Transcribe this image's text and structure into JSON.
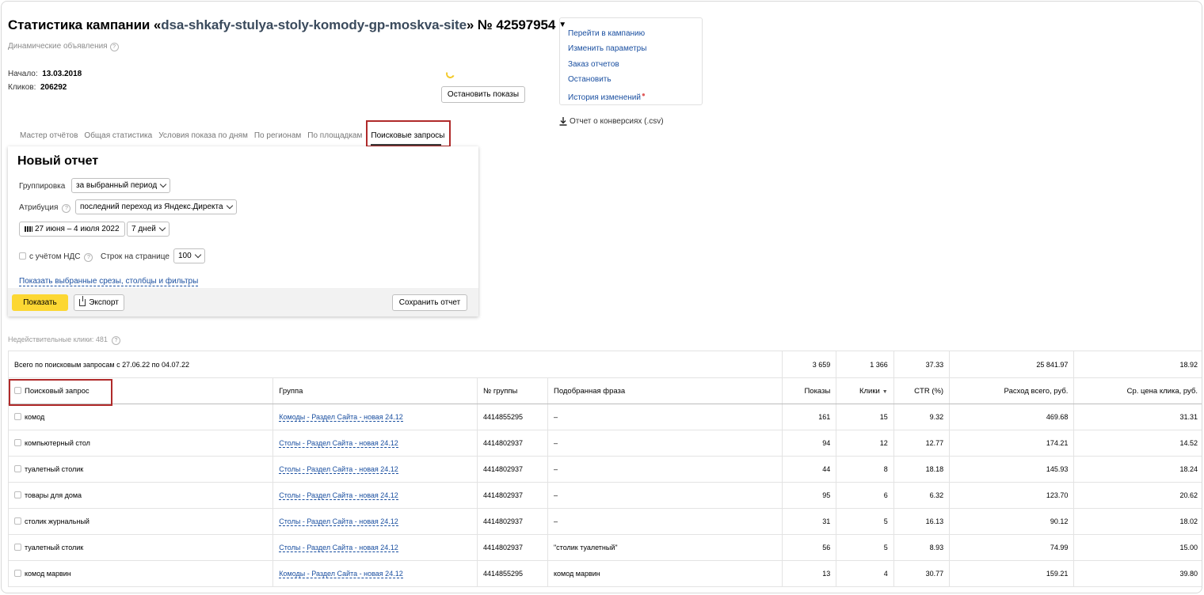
{
  "header": {
    "title_prefix": "Статистика кампании «",
    "campaign_name": "dsa-shkafy-stulya-stoly-komody-gp-moskva-site",
    "title_suffix": "» № 42597954",
    "subtitle": "Динамические объявления",
    "start_label": "Начало:",
    "start_value": "13.03.2018",
    "clicks_label": "Кликов:",
    "clicks_value": "206292",
    "stop_impressions_label": "Остановить показы"
  },
  "links": {
    "items": [
      "Перейти в кампанию",
      "Изменить параметры",
      "Заказ отчетов",
      "Остановить",
      "История изменений"
    ],
    "conversions_label": "Отчет о конверсиях (.csv)"
  },
  "tabs": [
    "Мастер отчётов",
    "Общая статистика",
    "Условия показа по дням",
    "По регионам",
    "По площадкам",
    "Поисковые запросы"
  ],
  "report": {
    "title": "Новый отчет",
    "grouping_label": "Группировка",
    "grouping_value": "за выбранный период",
    "attribution_label": "Атрибуция",
    "attribution_value": "последний переход из Яндекс.Директа",
    "date_range": "27 июня – 4 июля 2022",
    "period_value": "7 дней",
    "vat_label": "с учётом НДС",
    "rows_label": "Строк на странице",
    "rows_value": "100",
    "show_slices_link": "Показать выбранные срезы, столбцы и фильтры",
    "show_button": "Показать",
    "export_button": "Экспорт",
    "save_button": "Сохранить отчет"
  },
  "invalid_clicks": "Недействительные клики: 481",
  "table": {
    "total_label": "Всего по поисковым запросам с 27.06.22 по 04.07.22",
    "totals": [
      "3 659",
      "1 366",
      "37.33",
      "25 841.97",
      "18.92"
    ],
    "headers": [
      "Поисковый запрос",
      "Группа",
      "№ группы",
      "Подобранная фраза",
      "Показы",
      "Клики",
      "CTR (%)",
      "Расход всего, руб.",
      "Ср. цена клика, руб."
    ],
    "rows": [
      {
        "query": "комод",
        "group": "Комоды - Раздел Сайта - новая 24.12",
        "group_id": "4414855295",
        "phrase": "–",
        "impressions": "161",
        "clicks": "15",
        "ctr": "9.32",
        "cost": "469.68",
        "cpc": "31.31"
      },
      {
        "query": "компьютерный стол",
        "group": "Столы - Раздел Сайта - новая 24.12",
        "group_id": "4414802937",
        "phrase": "–",
        "impressions": "94",
        "clicks": "12",
        "ctr": "12.77",
        "cost": "174.21",
        "cpc": "14.52"
      },
      {
        "query": "туалетный столик",
        "group": "Столы - Раздел Сайта - новая 24.12",
        "group_id": "4414802937",
        "phrase": "–",
        "impressions": "44",
        "clicks": "8",
        "ctr": "18.18",
        "cost": "145.93",
        "cpc": "18.24"
      },
      {
        "query": "товары для дома",
        "group": "Столы - Раздел Сайта - новая 24.12",
        "group_id": "4414802937",
        "phrase": "–",
        "impressions": "95",
        "clicks": "6",
        "ctr": "6.32",
        "cost": "123.70",
        "cpc": "20.62"
      },
      {
        "query": "столик журнальный",
        "group": "Столы - Раздел Сайта - новая 24.12",
        "group_id": "4414802937",
        "phrase": "–",
        "impressions": "31",
        "clicks": "5",
        "ctr": "16.13",
        "cost": "90.12",
        "cpc": "18.02"
      },
      {
        "query": "туалетный столик",
        "group": "Столы - Раздел Сайта - новая 24.12",
        "group_id": "4414802937",
        "phrase": "\"столик туалетный\"",
        "impressions": "56",
        "clicks": "5",
        "ctr": "8.93",
        "cost": "74.99",
        "cpc": "15.00"
      },
      {
        "query": "комод марвин",
        "group": "Комоды - Раздел Сайта - новая 24.12",
        "group_id": "4414855295",
        "phrase": "комод марвин",
        "impressions": "13",
        "clicks": "4",
        "ctr": "30.77",
        "cost": "159.21",
        "cpc": "39.80"
      }
    ]
  }
}
